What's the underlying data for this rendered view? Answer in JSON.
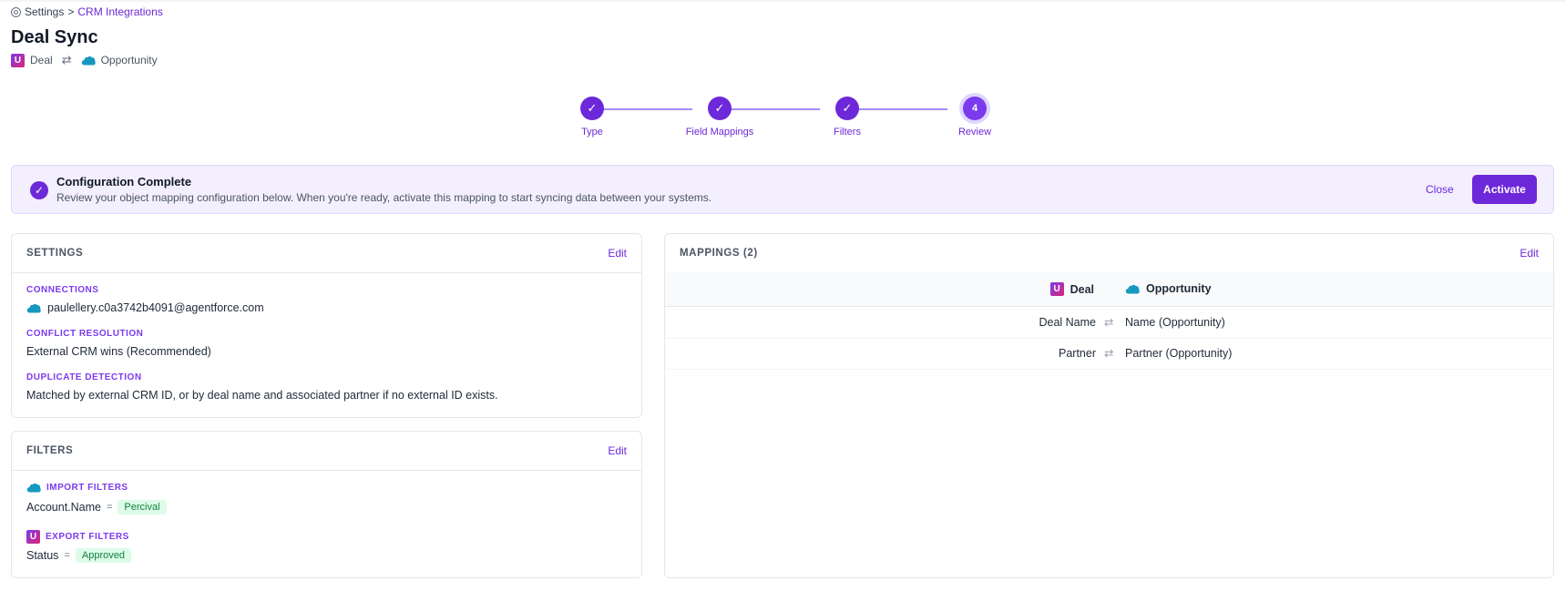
{
  "breadcrumb": {
    "root": "Settings",
    "separator": ">",
    "current": "CRM Integrations"
  },
  "page": {
    "title": "Deal Sync",
    "source_object": "Deal",
    "target_object": "Opportunity"
  },
  "stepper": {
    "steps": [
      {
        "label": "Type",
        "state": "done"
      },
      {
        "label": "Field Mappings",
        "state": "done"
      },
      {
        "label": "Filters",
        "state": "done"
      },
      {
        "label": "Review",
        "state": "current",
        "number": "4"
      }
    ]
  },
  "banner": {
    "title": "Configuration Complete",
    "description": "Review your object mapping configuration below. When you're ready, activate this mapping to start syncing data between your systems.",
    "close_label": "Close",
    "activate_label": "Activate"
  },
  "settings": {
    "title": "SETTINGS",
    "edit_label": "Edit",
    "connections_label": "CONNECTIONS",
    "connection_value": "paulellery.c0a3742b4091@agentforce.com",
    "conflict_label": "CONFLICT RESOLUTION",
    "conflict_value": "External CRM wins (Recommended)",
    "duplicate_label": "DUPLICATE DETECTION",
    "duplicate_value": "Matched by external CRM ID, or by deal name and associated partner if no external ID exists."
  },
  "filters": {
    "title": "FILTERS",
    "edit_label": "Edit",
    "import_label": "IMPORT FILTERS",
    "import_field": "Account.Name",
    "import_op": "=",
    "import_value": "Percival",
    "export_label": "EXPORT FILTERS",
    "export_field": "Status",
    "export_op": "=",
    "export_value": "Approved"
  },
  "mappings": {
    "title": "MAPPINGS (2)",
    "edit_label": "Edit",
    "source_header": "Deal",
    "target_header": "Opportunity",
    "rows": [
      {
        "source": "Deal Name",
        "target": "Name (Opportunity)"
      },
      {
        "source": "Partner",
        "target": "Partner (Opportunity)"
      }
    ]
  },
  "icons": {
    "logo_u": "U",
    "check": "✓",
    "swap": "⇄"
  },
  "colors": {
    "accent": "#6d28d9",
    "banner_bg": "#f3effe",
    "pill_bg": "#dcfce7",
    "pill_text": "#15803d",
    "salesforce_blue": "#1798c1"
  }
}
